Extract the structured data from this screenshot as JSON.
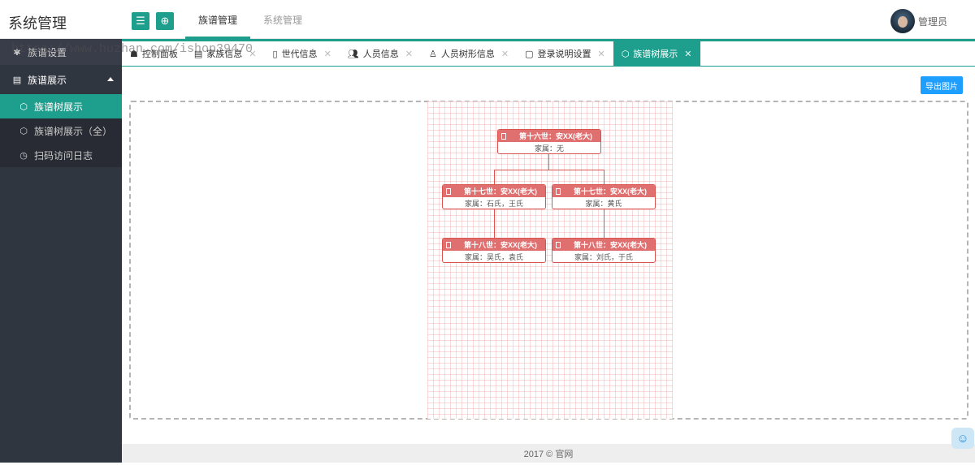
{
  "app": {
    "title": "系统管理"
  },
  "header": {
    "menu_icon": "menu-icon",
    "globe_icon": "globe-icon",
    "nav": [
      {
        "label": "族谱管理",
        "active": true
      },
      {
        "label": "系统管理",
        "active": false
      }
    ],
    "user": {
      "name": "管理员"
    }
  },
  "watermark": "https://www.huzhan.com/ishop39470",
  "sidebar": {
    "top_label": "族谱设置",
    "group": {
      "label": "族谱展示",
      "icon": "book-icon"
    },
    "items": [
      {
        "label": "族谱树展示",
        "icon": "cube-icon",
        "active": true
      },
      {
        "label": "族谱树展示（全）",
        "icon": "cube-icon",
        "active": false
      },
      {
        "label": "扫码访问日志",
        "icon": "clock-icon",
        "active": false
      }
    ]
  },
  "tabs": [
    {
      "label": "控制面板",
      "icon": "dashboard-icon",
      "closable": false,
      "active": false
    },
    {
      "label": "家族信息",
      "icon": "list-icon",
      "closable": true,
      "active": false
    },
    {
      "label": "世代信息",
      "icon": "file-icon",
      "closable": true,
      "active": false
    },
    {
      "label": "人员信息",
      "icon": "users-icon",
      "closable": true,
      "active": false
    },
    {
      "label": "人员树形信息",
      "icon": "user-icon",
      "closable": true,
      "active": false
    },
    {
      "label": "登录说明设置",
      "icon": "doc-icon",
      "closable": true,
      "active": false
    },
    {
      "label": "族谱树展示",
      "icon": "cube-icon",
      "closable": true,
      "active": true
    }
  ],
  "toolbar": {
    "export_label": "导出图片"
  },
  "tree": {
    "root": {
      "title": "第十六世：安XX(老大)",
      "spouse": "家属：无"
    },
    "gen2": [
      {
        "title": "第十七世：安XX(老大)",
        "spouse": "家属：石氏，王氏"
      },
      {
        "title": "第十七世：安XX(老大)",
        "spouse": "家属：黄氏"
      }
    ],
    "gen3": [
      {
        "title": "第十八世：安XX(老大)",
        "spouse": "家属：吴氏，袁氏"
      },
      {
        "title": "第十八世：安XX(老大)",
        "spouse": "家属：刘氏，于氏"
      }
    ]
  },
  "footer": {
    "text": "2017 ©  官网"
  },
  "colors": {
    "accent": "#1e9f8d",
    "node": "#e07070",
    "button": "#1e9fff"
  }
}
